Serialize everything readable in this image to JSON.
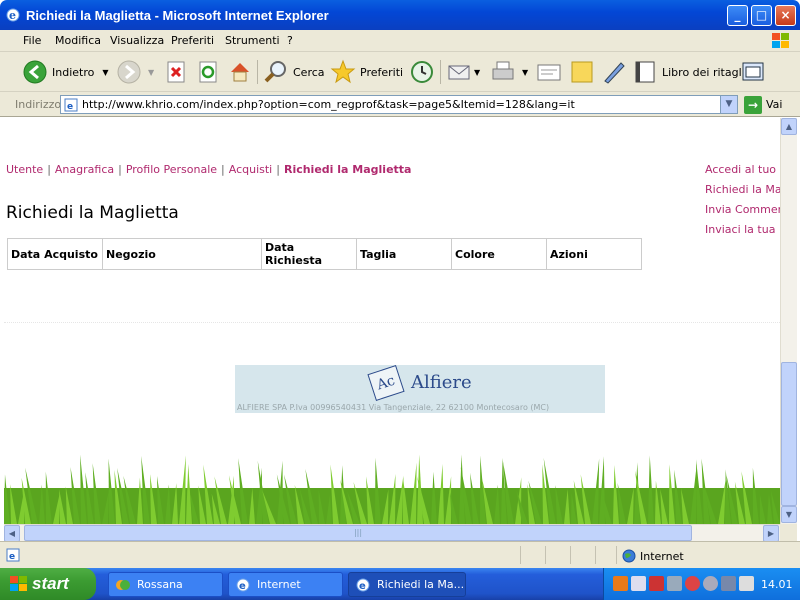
{
  "window": {
    "title": "Richiedi la Maglietta - Microsoft Internet Explorer",
    "buttons": {
      "minimize": "_",
      "maximize": "□",
      "close": "×"
    }
  },
  "menu": [
    "File",
    "Modifica",
    "Visualizza",
    "Preferiti",
    "Strumenti",
    "?"
  ],
  "toolbar": {
    "back": "Indietro",
    "search": "Cerca",
    "favorites": "Preferiti",
    "scrapbook": "Libro dei ritagli"
  },
  "address": {
    "label": "Indirizzo",
    "url": "http://www.khrio.com/index.php?option=com_regprof&task=page5&Itemid=128&lang=it",
    "go": "Vai"
  },
  "page": {
    "breadcrumbs": [
      {
        "label": "Utente"
      },
      {
        "label": "Anagrafica"
      },
      {
        "label": "Profilo Personale"
      },
      {
        "label": "Acquisti"
      }
    ],
    "current": "Richiedi la Maglietta",
    "separator": "|",
    "title": "Richiedi la Maglietta",
    "table_headers": [
      "Data Acquisto",
      "Negozio",
      "Data Richiesta",
      "Taglia",
      "Colore",
      "Azioni"
    ],
    "right_links": [
      "Accedi al tuo Pr",
      "Richiedi la Magl",
      "Invia Comment",
      "Inviaci la tua F"
    ],
    "sponsor": {
      "logo_text": "Ac",
      "name": "Alfiere",
      "address": "ALFIERE SPA P.Iva 00996540431 Via Tangenziale, 22 62100 Montecosaro (MC)"
    }
  },
  "status": {
    "zone": "Internet"
  },
  "taskbar": {
    "start": "start",
    "tasks": [
      {
        "label": "Rossana"
      },
      {
        "label": "Internet"
      },
      {
        "label": "Richiedi la Ma..."
      }
    ],
    "clock": "14.01"
  },
  "colors": {
    "link": "#b0296e",
    "title_bar": "#0347d6",
    "taskbar": "#245edb",
    "start": "#3c9c32"
  }
}
